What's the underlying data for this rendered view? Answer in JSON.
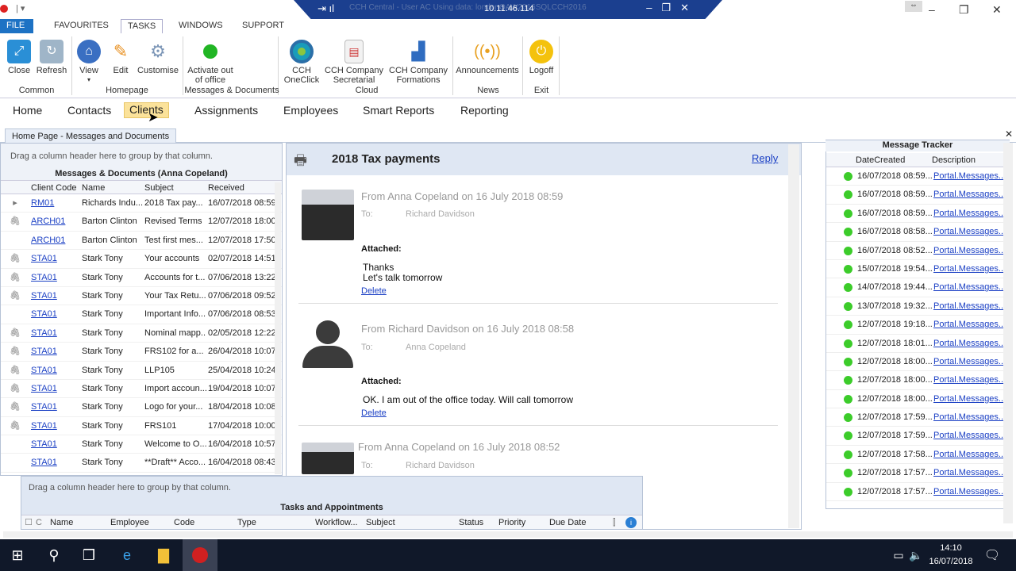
{
  "window": {
    "remote_ip": "10.11.46.114",
    "remote_title_faded": "CCH Central - User AC Using data: londonQAW2016SQLCCH2016"
  },
  "menu": [
    "FILE",
    "FAVOURITES",
    "TASKS",
    "WINDOWS",
    "SUPPORT"
  ],
  "ribbon": {
    "buttons": {
      "close": "Close",
      "refresh": "Refresh",
      "view": "View",
      "edit": "Edit",
      "customise": "Customise",
      "activate": "Activate out of office",
      "oneclick": "CCH OneClick",
      "secretarial": "CCH Company Secretarial",
      "formations": "CCH Company Formations",
      "announcements": "Announcements",
      "logoff": "Logoff"
    },
    "groups": {
      "common": "Common",
      "homepage": "Homepage",
      "messages": "Messages & Documents",
      "cloud": "Cloud",
      "news": "News",
      "exit": "Exit"
    }
  },
  "nav": [
    "Home",
    "Contacts",
    "Clients",
    "Assignments",
    "Employees",
    "Smart Reports",
    "Reporting"
  ],
  "tab": {
    "label": "Home Page - Messages and Documents"
  },
  "left_grid": {
    "group_hint": "Drag a column header here to group by that column.",
    "title": "Messages & Documents (Anna Copeland)",
    "columns": [
      "Client Code",
      "Name",
      "Subject",
      "Received"
    ],
    "rows": [
      {
        "icon": "",
        "code": "RM01",
        "name": "Richards Indu...",
        "subject": "2018 Tax pay...",
        "received": "16/07/2018 08:59"
      },
      {
        "icon": "clip",
        "code": "ARCH01",
        "name": "Barton Clinton",
        "subject": "Revised Terms",
        "received": "12/07/2018 18:00"
      },
      {
        "icon": "",
        "code": "ARCH01",
        "name": "Barton Clinton",
        "subject": "Test first mes...",
        "received": "12/07/2018 17:50"
      },
      {
        "icon": "clip",
        "code": "STA01",
        "name": "Stark Tony",
        "subject": "Your accounts",
        "received": "02/07/2018 14:51"
      },
      {
        "icon": "clip",
        "code": "STA01",
        "name": "Stark Tony",
        "subject": "Accounts for t...",
        "received": "07/06/2018 13:22"
      },
      {
        "icon": "clip",
        "code": "STA01",
        "name": "Stark Tony",
        "subject": "Your Tax Retu...",
        "received": "07/06/2018 09:52"
      },
      {
        "icon": "",
        "code": "STA01",
        "name": "Stark Tony",
        "subject": "Important Info...",
        "received": "07/06/2018 08:53"
      },
      {
        "icon": "clip",
        "code": "STA01",
        "name": "Stark Tony",
        "subject": "Nominal mapp...",
        "received": "02/05/2018 12:22"
      },
      {
        "icon": "clip",
        "code": "STA01",
        "name": "Stark Tony",
        "subject": "FRS102 for a...",
        "received": "26/04/2018 10:07"
      },
      {
        "icon": "clip",
        "code": "STA01",
        "name": "Stark Tony",
        "subject": "LLP105",
        "received": "25/04/2018 10:24"
      },
      {
        "icon": "clip",
        "code": "STA01",
        "name": "Stark Tony",
        "subject": "Import accoun...",
        "received": "19/04/2018 10:07"
      },
      {
        "icon": "clip",
        "code": "STA01",
        "name": "Stark Tony",
        "subject": "Logo for your...",
        "received": "18/04/2018 10:08"
      },
      {
        "icon": "clip",
        "code": "STA01",
        "name": "Stark Tony",
        "subject": "FRS101",
        "received": "17/04/2018 10:00"
      },
      {
        "icon": "",
        "code": "STA01",
        "name": "Stark Tony",
        "subject": "Welcome to O...",
        "received": "16/04/2018 10:57"
      },
      {
        "icon": "",
        "code": "STA01",
        "name": "Stark Tony",
        "subject": "**Draft** Acco...",
        "received": "16/04/2018 08:43"
      }
    ]
  },
  "center": {
    "title": "2018 Tax payments",
    "reply": "Reply",
    "to_label": "To:",
    "attached_label": "Attached:",
    "delete_label": "Delete",
    "messages": [
      {
        "from": "From Anna Copeland on 16 July 2018 08:59",
        "to": "Richard Davidson",
        "line1": "Thanks",
        "line2": "Let's talk tomorrow"
      },
      {
        "from": "From Richard Davidson on 16 July 2018 08:58",
        "to": "Anna Copeland",
        "line1": "OK. I am out of the office today. Will call tomorrow",
        "line2": ""
      },
      {
        "from": "From Anna Copeland on 16 July 2018 08:52",
        "to": "Richard Davidson",
        "line1": "",
        "line2": ""
      }
    ]
  },
  "tracker": {
    "title": "Message Tracker",
    "columns": [
      "DateCreated",
      "Description"
    ],
    "rows": [
      {
        "date": "16/07/2018 08:59...",
        "desc": "Portal.Messages...."
      },
      {
        "date": "16/07/2018 08:59...",
        "desc": "Portal.Messages...."
      },
      {
        "date": "16/07/2018 08:59...",
        "desc": "Portal.Messages...."
      },
      {
        "date": "16/07/2018 08:58...",
        "desc": "Portal.Messages...."
      },
      {
        "date": "16/07/2018 08:52...",
        "desc": "Portal.Messages...."
      },
      {
        "date": "15/07/2018 19:54...",
        "desc": "Portal.Messages...."
      },
      {
        "date": "14/07/2018 19:44...",
        "desc": "Portal.Messages...."
      },
      {
        "date": "13/07/2018 19:32...",
        "desc": "Portal.Messages...."
      },
      {
        "date": "12/07/2018 19:18...",
        "desc": "Portal.Messages...."
      },
      {
        "date": "12/07/2018 18:01...",
        "desc": "Portal.Messages...."
      },
      {
        "date": "12/07/2018 18:00...",
        "desc": "Portal.Messages...."
      },
      {
        "date": "12/07/2018 18:00...",
        "desc": "Portal.Messages...."
      },
      {
        "date": "12/07/2018 18:00...",
        "desc": "Portal.Messages...."
      },
      {
        "date": "12/07/2018 17:59...",
        "desc": "Portal.Messages...."
      },
      {
        "date": "12/07/2018 17:59...",
        "desc": "Portal.Messages...."
      },
      {
        "date": "12/07/2018 17:58...",
        "desc": "Portal.Messages...."
      },
      {
        "date": "12/07/2018 17:57...",
        "desc": "Portal.Messages...."
      },
      {
        "date": "12/07/2018 17:57...",
        "desc": "Portal.Messages...."
      }
    ]
  },
  "tasks": {
    "group_hint": "Drag a column header here to group by that column.",
    "title": "Tasks and Appointments",
    "columns": [
      "Name",
      "Employee",
      "Code",
      "Type",
      "Workflow...",
      "Subject",
      "Status",
      "Priority",
      "Due Date"
    ]
  },
  "taskbar": {
    "time": "14:10",
    "date": "16/07/2018"
  }
}
